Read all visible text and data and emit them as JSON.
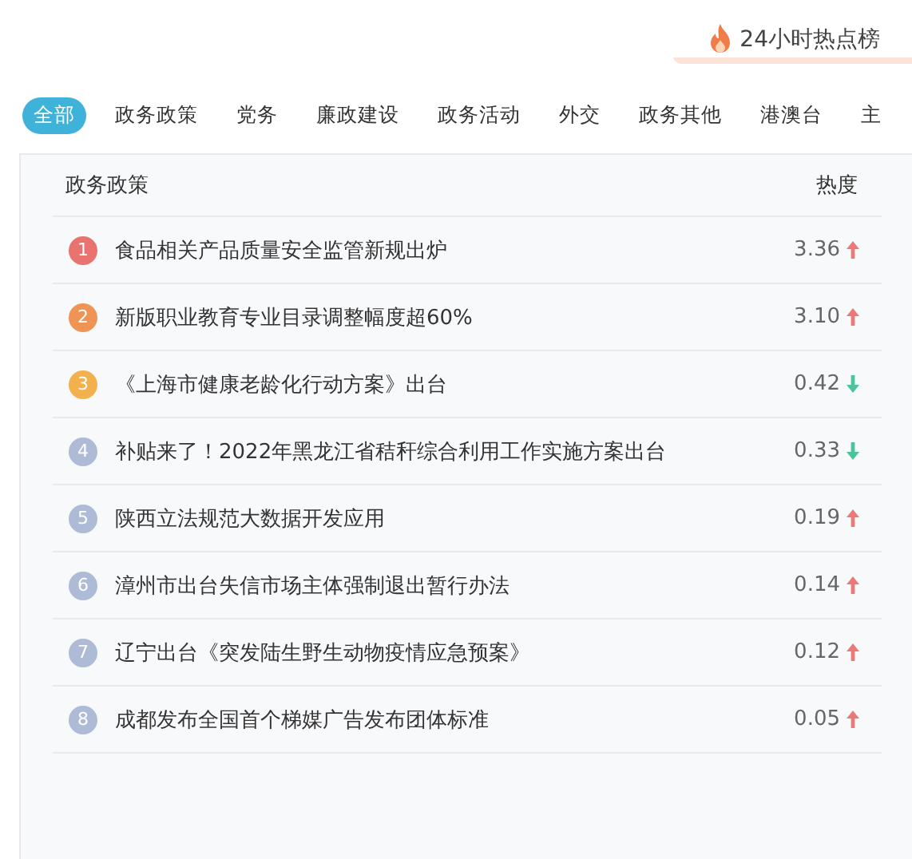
{
  "header": {
    "title": "24小时热点榜"
  },
  "tabs": [
    {
      "label": "全部",
      "selected": true
    },
    {
      "label": "政务政策",
      "selected": false
    },
    {
      "label": "党务",
      "selected": false
    },
    {
      "label": "廉政建设",
      "selected": false
    },
    {
      "label": "政务活动",
      "selected": false
    },
    {
      "label": "外交",
      "selected": false
    },
    {
      "label": "政务其他",
      "selected": false
    },
    {
      "label": "港澳台",
      "selected": false
    },
    {
      "label": "主",
      "selected": false
    }
  ],
  "list": {
    "columns": [
      "政务政策",
      "热度"
    ],
    "rows": [
      {
        "rank": "1",
        "color": "#e8736f",
        "title": "食品相关产品质量安全监管新规出炉",
        "score": "3.36",
        "kind": "rising"
      },
      {
        "rank": "2",
        "color": "#ee9556",
        "title": "新版职业教育专业目录调整幅度超60%",
        "score": "3.10",
        "kind": "rising"
      },
      {
        "rank": "3",
        "color": "#f2b14c",
        "title": "《上海市健康老龄化行动方案》出台",
        "score": "0.42",
        "kind": "falling"
      },
      {
        "rank": "4",
        "color": "#aebbd6",
        "title": "补贴来了！2022年黑龙江省秸秆综合利用工作实施方案出台",
        "score": "0.33",
        "kind": "falling"
      },
      {
        "rank": "5",
        "color": "#aebbd6",
        "title": "陕西立法规范大数据开发应用",
        "score": "0.19",
        "kind": "rising"
      },
      {
        "rank": "6",
        "color": "#aebbd6",
        "title": "漳州市出台失信市场主体强制退出暂行办法",
        "score": "0.14",
        "kind": "rising"
      },
      {
        "rank": "7",
        "color": "#aebbd6",
        "title": "辽宁出台《突发陆生野生动物疫情应急预案》",
        "score": "0.12",
        "kind": "rising"
      },
      {
        "rank": "8",
        "color": "#aebbd6",
        "title": "成都发布全国首个梯媒广告发布团体标准",
        "score": "0.05",
        "kind": "rising"
      }
    ]
  }
}
